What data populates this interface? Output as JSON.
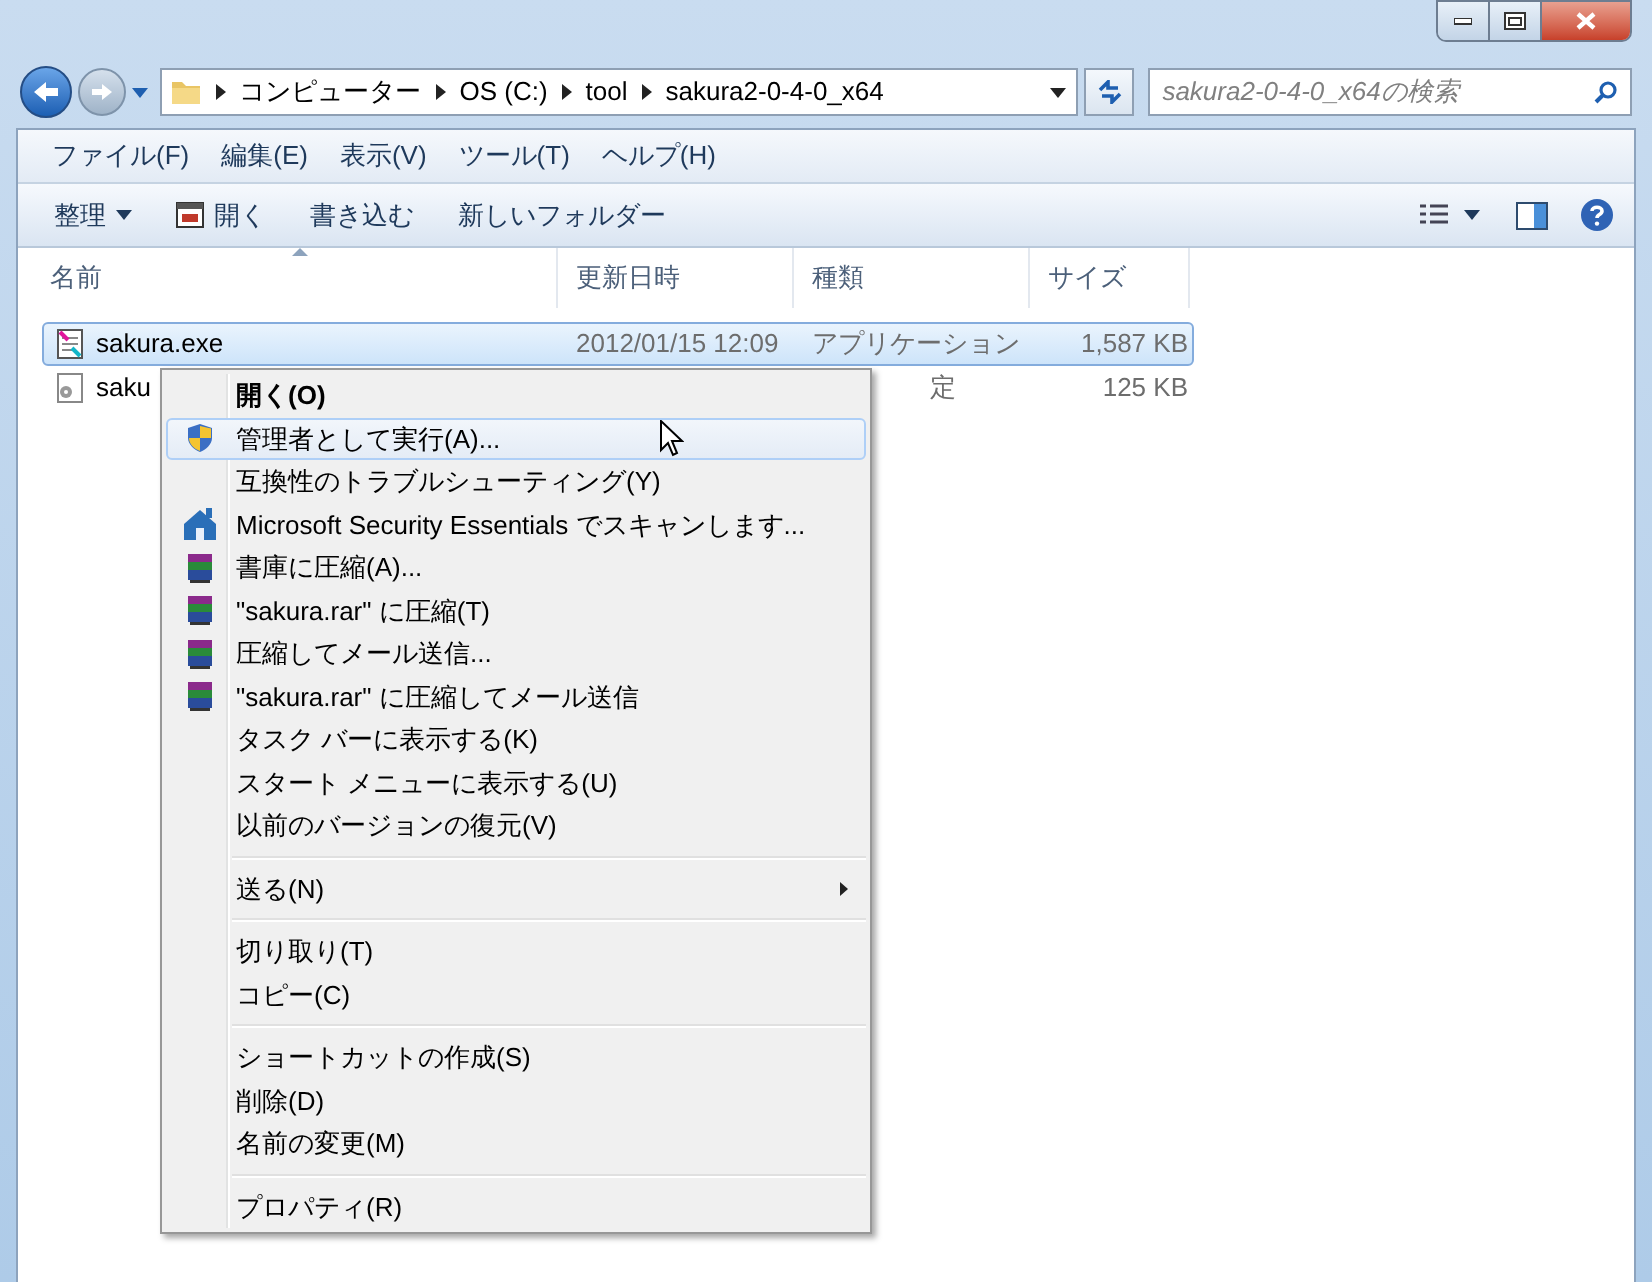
{
  "address": {
    "crumbs": [
      "コンピューター",
      "OS (C:)",
      "tool",
      "sakura2-0-4-0_x64"
    ]
  },
  "search": {
    "placeholder": "sakura2-0-4-0_x64の検索"
  },
  "menubar": [
    "ファイル(F)",
    "編集(E)",
    "表示(V)",
    "ツール(T)",
    "ヘルプ(H)"
  ],
  "toolbar": [
    {
      "label": "整理",
      "kind": "dropdown"
    },
    {
      "label": "開く",
      "kind": "open"
    },
    {
      "label": "書き込む",
      "kind": "plain"
    },
    {
      "label": "新しいフォルダー",
      "kind": "plain"
    }
  ],
  "columns": [
    "名前",
    "更新日時",
    "種類",
    "サイズ"
  ],
  "files": [
    {
      "name": "sakura.exe",
      "date": "2012/01/15 12:09",
      "type": "アプリケーション",
      "size": "1,587 KB",
      "kind": "app",
      "selected": true
    },
    {
      "name": "saku",
      "type": "定",
      "size": "125 KB",
      "kind": "config",
      "selected": false
    }
  ],
  "context_menu": [
    {
      "kind": "plain",
      "label": "開く(O)",
      "default": true,
      "selected": false,
      "submenu": false
    },
    {
      "kind": "shield",
      "label": "管理者として実行(A)...",
      "default": false,
      "selected": true,
      "submenu": false
    },
    {
      "kind": "plain",
      "label": "互換性のトラブルシューティング(Y)",
      "default": false,
      "selected": false,
      "submenu": false
    },
    {
      "kind": "scan",
      "label": "Microsoft Security Essentials でスキャンします...",
      "default": false,
      "selected": false,
      "submenu": false
    },
    {
      "kind": "archive",
      "label": "書庫に圧縮(A)...",
      "default": false,
      "selected": false,
      "submenu": false
    },
    {
      "kind": "archive",
      "label": "\"sakura.rar\" に圧縮(T)",
      "default": false,
      "selected": false,
      "submenu": false
    },
    {
      "kind": "archive",
      "label": "圧縮してメール送信...",
      "default": false,
      "selected": false,
      "submenu": false
    },
    {
      "kind": "archive",
      "label": "\"sakura.rar\" に圧縮してメール送信",
      "default": false,
      "selected": false,
      "submenu": false
    },
    {
      "kind": "plain",
      "label": "タスク バーに表示する(K)",
      "default": false,
      "selected": false,
      "submenu": false
    },
    {
      "kind": "plain",
      "label": "スタート メニューに表示する(U)",
      "default": false,
      "selected": false,
      "submenu": false
    },
    {
      "kind": "plain",
      "label": "以前のバージョンの復元(V)",
      "default": false,
      "selected": false,
      "submenu": false
    },
    {
      "kind": "separator"
    },
    {
      "kind": "plain",
      "label": "送る(N)",
      "default": false,
      "selected": false,
      "submenu": true
    },
    {
      "kind": "separator"
    },
    {
      "kind": "plain",
      "label": "切り取り(T)",
      "default": false,
      "selected": false,
      "submenu": false
    },
    {
      "kind": "plain",
      "label": "コピー(C)",
      "default": false,
      "selected": false,
      "submenu": false
    },
    {
      "kind": "separator"
    },
    {
      "kind": "plain",
      "label": "ショートカットの作成(S)",
      "default": false,
      "selected": false,
      "submenu": false
    },
    {
      "kind": "plain",
      "label": "削除(D)",
      "default": false,
      "selected": false,
      "submenu": false
    },
    {
      "kind": "plain",
      "label": "名前の変更(M)",
      "default": false,
      "selected": false,
      "submenu": false
    },
    {
      "kind": "separator"
    },
    {
      "kind": "plain",
      "label": "プロパティ(R)",
      "default": false,
      "selected": false,
      "submenu": false
    }
  ]
}
